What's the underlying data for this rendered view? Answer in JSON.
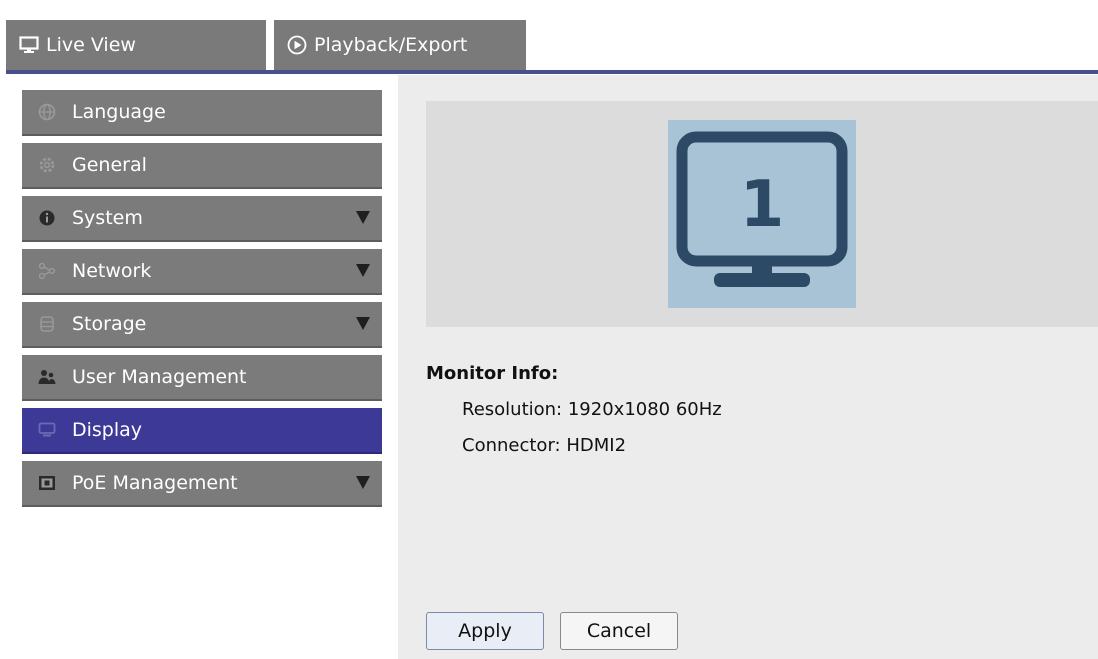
{
  "tabs": {
    "live_view": {
      "label": "Live View",
      "icon": "monitor-icon"
    },
    "playback": {
      "label": "Playback/Export",
      "icon": "play-circle-icon"
    },
    "underline_color": "#4a4e8a"
  },
  "sidebar": {
    "items": [
      {
        "label": "Language",
        "icon": "globe-icon",
        "expandable": false,
        "active": false
      },
      {
        "label": "General",
        "icon": "gear-icon",
        "expandable": false,
        "active": false
      },
      {
        "label": "System",
        "icon": "info-icon",
        "expandable": true,
        "active": false
      },
      {
        "label": "Network",
        "icon": "network-icon",
        "expandable": true,
        "active": false
      },
      {
        "label": "Storage",
        "icon": "database-icon",
        "expandable": true,
        "active": false
      },
      {
        "label": "User Management",
        "icon": "users-icon",
        "expandable": false,
        "active": false
      },
      {
        "label": "Display",
        "icon": "display-icon",
        "expandable": false,
        "active": true
      },
      {
        "label": "PoE Management",
        "icon": "poe-icon",
        "expandable": true,
        "active": false
      }
    ],
    "active_color": "#3c3a96",
    "item_color": "#7b7b7b"
  },
  "main": {
    "monitor": {
      "number": "1",
      "tile_color": "#a8c2d6",
      "icon_color": "#2c4a66"
    },
    "info_title": "Monitor Info:",
    "resolution_label": "Resolution:",
    "resolution_value": "1920x1080 60Hz",
    "connector_label": "Connector:",
    "connector_value": "HDMI2",
    "apply_label": "Apply",
    "cancel_label": "Cancel"
  }
}
